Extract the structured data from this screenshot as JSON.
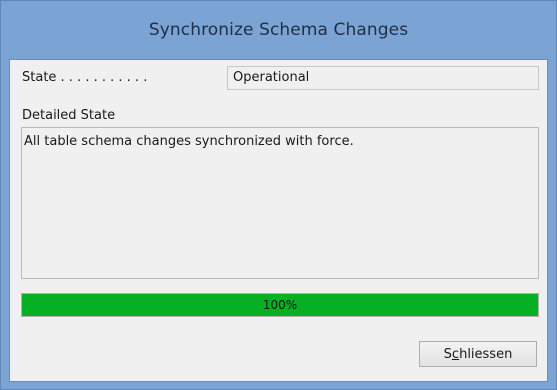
{
  "window": {
    "title": "Synchronize Schema Changes"
  },
  "state": {
    "label": "State . . . . . . . . . . .",
    "value": "Operational"
  },
  "detail": {
    "label": "Detailed State",
    "text": "All table schema changes synchronized with force."
  },
  "progress": {
    "value_percent": 100,
    "label": "100%",
    "fill_color": "#06b025"
  },
  "buttons": {
    "close": {
      "mnemonic_char": "c",
      "prefix": "S",
      "suffix": "hliessen"
    }
  },
  "colors": {
    "frame": "#7ba3d4",
    "client_bg": "#f0f0f0"
  }
}
